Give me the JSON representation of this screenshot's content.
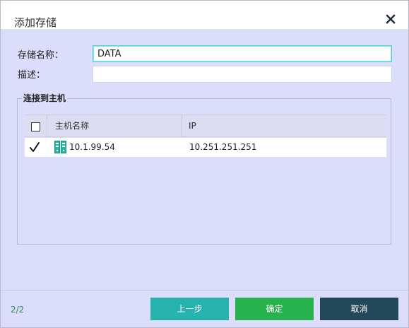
{
  "dialog": {
    "title": "添加存储",
    "close_icon": "close-icon"
  },
  "form": {
    "name_label": "存储名称：",
    "name_value": "DATA",
    "desc_label": "描述：",
    "desc_value": ""
  },
  "hosts": {
    "legend": "连接到主机",
    "columns": [
      "主机名称",
      "IP"
    ],
    "header_checkbox_checked": false,
    "rows": [
      {
        "checked": true,
        "host_icon": "server-icon",
        "name": "10.1.99.54",
        "ip": "10.251.251.251"
      }
    ]
  },
  "footer": {
    "page": "2/2",
    "prev_label": "上一步",
    "ok_label": "确定",
    "cancel_label": "取消"
  },
  "colors": {
    "accent": "#27b3ad",
    "ok": "#27b24e",
    "cancel": "#234859",
    "dialog_bg": "#dcdcfb"
  }
}
